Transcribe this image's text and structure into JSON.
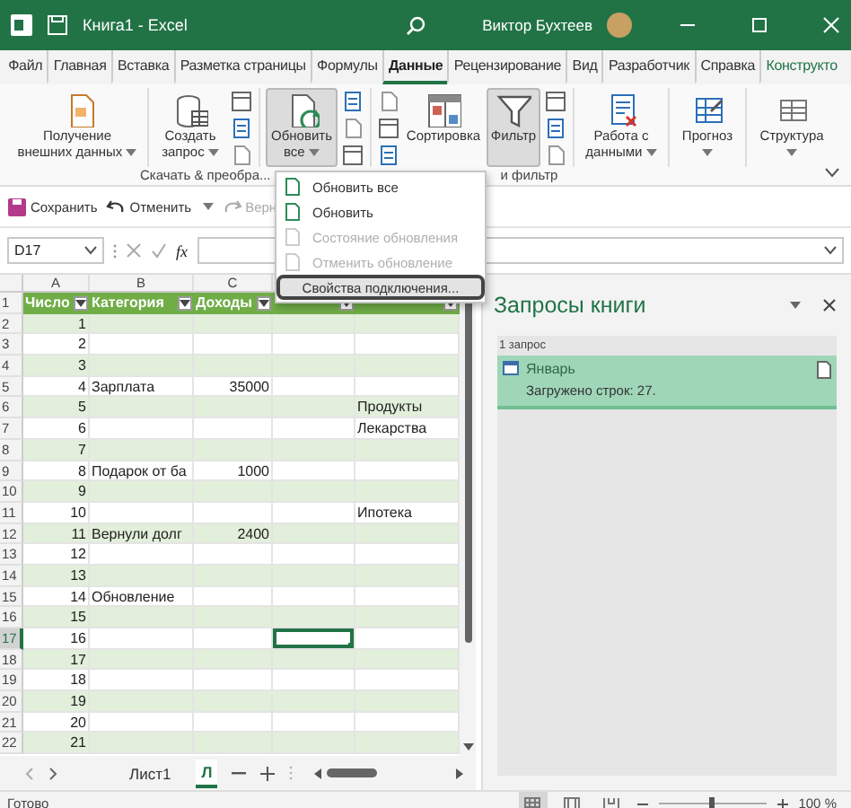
{
  "window": {
    "title": "Книга1 - Excel",
    "user": "Виктор Бухтеев"
  },
  "ribbon_tabs": [
    {
      "label": "Файл",
      "selected": false,
      "kind": "normal"
    },
    {
      "label": "Главная",
      "selected": false,
      "kind": "normal"
    },
    {
      "label": "Вставка",
      "selected": false,
      "kind": "normal"
    },
    {
      "label": "Разметка страницы",
      "selected": false,
      "kind": "normal"
    },
    {
      "label": "Формулы",
      "selected": false,
      "kind": "normal"
    },
    {
      "label": "Данные",
      "selected": true,
      "kind": "normal"
    },
    {
      "label": "Рецензирование",
      "selected": false,
      "kind": "normal"
    },
    {
      "label": "Вид",
      "selected": false,
      "kind": "normal"
    },
    {
      "label": "Разработчик",
      "selected": false,
      "kind": "normal"
    },
    {
      "label": "Справка",
      "selected": false,
      "kind": "normal"
    },
    {
      "label": "Конструкто",
      "selected": false,
      "kind": "contextual"
    }
  ],
  "ribbon": {
    "groups": [
      {
        "items": [
          {
            "kind": "large",
            "label": "Получение внешних данных",
            "pressed": false,
            "dropdown": true
          }
        ]
      },
      {
        "items": [
          {
            "kind": "large",
            "label": "Создать запрос",
            "pressed": false,
            "dropdown": true
          },
          {
            "kind": "icons"
          }
        ],
        "label": "Скачать & преобра..."
      },
      {
        "items": [
          {
            "kind": "large",
            "label": "Обновить все",
            "pressed": true,
            "dropdown": true
          },
          {
            "kind": "icons"
          }
        ]
      },
      {
        "items": [
          {
            "kind": "icons"
          },
          {
            "kind": "large",
            "label": "Сортировка",
            "pressed": false,
            "dropdown": false
          },
          {
            "kind": "large",
            "label": "Фильтр",
            "pressed": true,
            "dropdown": false
          },
          {
            "kind": "icons"
          }
        ],
        "label": "и фильтр"
      },
      {
        "items": [
          {
            "kind": "large",
            "label": "Работа с данными",
            "pressed": false,
            "dropdown": true
          }
        ]
      },
      {
        "items": [
          {
            "kind": "large",
            "label": "Прогноз",
            "pressed": false,
            "dropdown": true
          }
        ]
      },
      {
        "items": [
          {
            "kind": "large",
            "label": "Структура",
            "pressed": false,
            "dropdown": true
          }
        ]
      }
    ]
  },
  "quick_access": [
    {
      "kind": "save",
      "label": "Сохранить",
      "disabled": false,
      "dropdown": false
    },
    {
      "kind": "undo",
      "label": "Отменить",
      "disabled": false,
      "dropdown": true
    },
    {
      "kind": "redo",
      "label": "Верн",
      "disabled": true,
      "dropdown": false
    }
  ],
  "formula_bar": {
    "name_box": "D17",
    "function_label": "fx"
  },
  "refresh_menu": {
    "items": [
      {
        "label": "Обновить все",
        "disabled": false,
        "selected": false
      },
      {
        "label": "Обновить",
        "disabled": false,
        "selected": false
      },
      {
        "label": "Состояние обновления",
        "disabled": true,
        "selected": false
      },
      {
        "label": "Отменить обновление",
        "disabled": true,
        "selected": false
      },
      {
        "label": "Свойства подключения...",
        "disabled": false,
        "selected": true
      }
    ]
  },
  "sheet": {
    "column_headers": [
      {
        "label": "A",
        "selected": false
      },
      {
        "label": "B",
        "selected": false
      },
      {
        "label": "C",
        "selected": false
      }
    ],
    "header_row": {
      "number": "1",
      "labels": [
        "Число",
        "Категория",
        "Доходы"
      ]
    },
    "rows": [
      {
        "number": "2",
        "selected": false,
        "cells": [
          {
            "text": "1",
            "selected": false
          },
          {
            "selected": false
          },
          {
            "selected": false
          },
          {
            "selected": false
          },
          {
            "selected": false
          }
        ]
      },
      {
        "number": "3",
        "selected": false,
        "cells": [
          {
            "text": "2",
            "selected": false
          },
          {
            "selected": false
          },
          {
            "selected": false
          },
          {
            "selected": false
          },
          {
            "selected": false
          }
        ]
      },
      {
        "number": "4",
        "selected": false,
        "cells": [
          {
            "text": "3",
            "selected": false
          },
          {
            "selected": false
          },
          {
            "selected": false
          },
          {
            "selected": false
          },
          {
            "selected": false
          }
        ]
      },
      {
        "number": "5",
        "selected": false,
        "cells": [
          {
            "text": "4",
            "selected": false
          },
          {
            "text": "Зарплата",
            "selected": false
          },
          {
            "text": "35000",
            "selected": false
          },
          {
            "selected": false
          },
          {
            "selected": false
          }
        ]
      },
      {
        "number": "6",
        "selected": false,
        "cells": [
          {
            "text": "5",
            "selected": false
          },
          {
            "selected": false
          },
          {
            "selected": false
          },
          {
            "selected": false
          },
          {
            "text": "Продукты",
            "selected": false
          }
        ]
      },
      {
        "number": "7",
        "selected": false,
        "cells": [
          {
            "text": "6",
            "selected": false
          },
          {
            "selected": false
          },
          {
            "selected": false
          },
          {
            "selected": false
          },
          {
            "text": "Лекарства",
            "selected": false
          }
        ]
      },
      {
        "number": "8",
        "selected": false,
        "cells": [
          {
            "text": "7",
            "selected": false
          },
          {
            "selected": false
          },
          {
            "selected": false
          },
          {
            "selected": false
          },
          {
            "selected": false
          }
        ]
      },
      {
        "number": "9",
        "selected": false,
        "cells": [
          {
            "text": "8",
            "selected": false
          },
          {
            "text": "Подарок от ба",
            "selected": false
          },
          {
            "text": "1000",
            "selected": false
          },
          {
            "selected": false
          },
          {
            "selected": false
          }
        ]
      },
      {
        "number": "10",
        "selected": false,
        "cells": [
          {
            "text": "9",
            "selected": false
          },
          {
            "selected": false
          },
          {
            "selected": false
          },
          {
            "selected": false
          },
          {
            "selected": false
          }
        ]
      },
      {
        "number": "11",
        "selected": false,
        "cells": [
          {
            "text": "10",
            "selected": false
          },
          {
            "selected": false
          },
          {
            "selected": false
          },
          {
            "selected": false
          },
          {
            "text": "Ипотека",
            "selected": false
          }
        ]
      },
      {
        "number": "12",
        "selected": false,
        "cells": [
          {
            "text": "11",
            "selected": false
          },
          {
            "text": "Вернули долг",
            "selected": false
          },
          {
            "text": "2400",
            "selected": false
          },
          {
            "selected": false
          },
          {
            "selected": false
          }
        ]
      },
      {
        "number": "13",
        "selected": false,
        "cells": [
          {
            "text": "12",
            "selected": false
          },
          {
            "selected": false
          },
          {
            "selected": false
          },
          {
            "selected": false
          },
          {
            "selected": false
          }
        ]
      },
      {
        "number": "14",
        "selected": false,
        "cells": [
          {
            "text": "13",
            "selected": false
          },
          {
            "selected": false
          },
          {
            "selected": false
          },
          {
            "selected": false
          },
          {
            "selected": false
          }
        ]
      },
      {
        "number": "15",
        "selected": false,
        "cells": [
          {
            "text": "14",
            "selected": false
          },
          {
            "text": "Обновление",
            "selected": false
          },
          {
            "selected": false
          },
          {
            "selected": false
          },
          {
            "selected": false
          }
        ]
      },
      {
        "number": "16",
        "selected": false,
        "cells": [
          {
            "text": "15",
            "selected": false
          },
          {
            "selected": false
          },
          {
            "selected": false
          },
          {
            "selected": false
          },
          {
            "selected": false
          }
        ]
      },
      {
        "number": "17",
        "selected": true,
        "cells": [
          {
            "text": "16",
            "selected": false
          },
          {
            "selected": false
          },
          {
            "selected": false
          },
          {
            "selected": true
          },
          {
            "selected": false
          }
        ]
      },
      {
        "number": "18",
        "selected": false,
        "cells": [
          {
            "text": "17",
            "selected": false
          },
          {
            "selected": false
          },
          {
            "selected": false
          },
          {
            "selected": false
          },
          {
            "selected": false
          }
        ]
      },
      {
        "number": "19",
        "selected": false,
        "cells": [
          {
            "text": "18",
            "selected": false
          },
          {
            "selected": false
          },
          {
            "selected": false
          },
          {
            "selected": false
          },
          {
            "selected": false
          }
        ]
      },
      {
        "number": "20",
        "selected": false,
        "cells": [
          {
            "text": "19",
            "selected": false
          },
          {
            "selected": false
          },
          {
            "selected": false
          },
          {
            "selected": false
          },
          {
            "selected": false
          }
        ]
      },
      {
        "number": "21",
        "selected": false,
        "cells": [
          {
            "text": "20",
            "selected": false
          },
          {
            "selected": false
          },
          {
            "selected": false
          },
          {
            "selected": false
          },
          {
            "selected": false
          }
        ]
      },
      {
        "number": "22",
        "selected": false,
        "cells": [
          {
            "text": "21",
            "selected": false
          },
          {
            "selected": false
          },
          {
            "selected": false
          },
          {
            "selected": false
          },
          {
            "selected": false
          }
        ]
      }
    ]
  },
  "sheet_tabs": [
    {
      "label": "Лист1",
      "selected": false
    },
    {
      "label": "Л",
      "selected": true
    }
  ],
  "queries_pane": {
    "title": "Запросы книги",
    "count": "1 запрос",
    "queries": [
      {
        "name": "Январь",
        "status": "Загружено строк: 27.",
        "selected": true
      }
    ]
  },
  "status_bar": {
    "status": "Готово",
    "views": [
      {
        "selected": true
      },
      {
        "selected": false
      },
      {
        "selected": false
      }
    ],
    "zoom_slider": {
      "level": 0.5
    },
    "zoom": "100 %"
  }
}
